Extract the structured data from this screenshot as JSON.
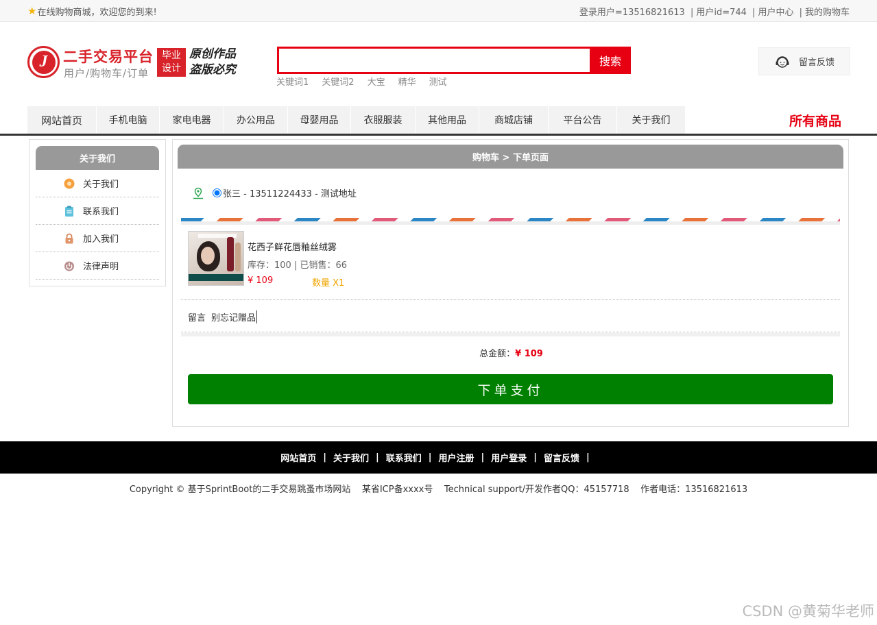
{
  "topbar": {
    "welcome": "在线购物商城，欢迎您的到来!",
    "login_user": "登录用户=13516821613",
    "user_id": "用户id=744",
    "user_center": "用户中心",
    "my_cart": "我的购物车",
    "sep": "|"
  },
  "header": {
    "logo_letter": "J",
    "logo_title": "二手交易平台",
    "logo_sub": "用户/购物车/订单",
    "badge_line1": "毕业",
    "badge_line2": "设计",
    "callig_line1": "原创作品",
    "callig_line2": "盗版必究",
    "search": {
      "value": "",
      "button_label": "搜索"
    },
    "keywords": [
      "关键词1",
      "关键词2",
      "大宝",
      "精华",
      "测试"
    ],
    "feedback_label": "留言反馈"
  },
  "nav": {
    "items": [
      "网站首页",
      "手机电脑",
      "家电电器",
      "办公用品",
      "母婴用品",
      "衣服服装",
      "其他用品",
      "商城店铺",
      "平台公告",
      "关于我们"
    ],
    "all_goods": "所有商品"
  },
  "sidebar": {
    "title": "关于我们",
    "items": [
      {
        "label": "关于我们",
        "icon": "orange-circle-icon"
      },
      {
        "label": "联系我们",
        "icon": "clipboard-icon"
      },
      {
        "label": "加入我们",
        "icon": "lock-icon"
      },
      {
        "label": "法律声明",
        "icon": "power-icon"
      }
    ]
  },
  "order": {
    "breadcrumb": "购物车 > 下单页面",
    "address": "张三 - 13511224433 - 测试地址",
    "product": {
      "name": "花西子鲜花唇釉丝绒雾",
      "stock": "库存：100 | 已销售：66",
      "price": "¥ 109",
      "qty": "数量 X1"
    },
    "note_label": "留言",
    "note_value": "别忘记赠品",
    "total_label": "总金额：",
    "total_value": "¥ 109",
    "pay_button": "下单支付"
  },
  "footer": {
    "links": [
      "网站首页",
      "关于我们",
      "联系我们",
      "用户注册",
      "用户登录",
      "留言反馈"
    ],
    "bar": "|",
    "copyright": "Copyright © 基于SprintBoot的二手交易跳蚤市场网站    某省ICP备xxxx号    Technical support/开发作者QQ：45157718    作者电话：13516821613"
  },
  "watermark": "CSDN @黄菊华老师",
  "colors": {
    "accent_red": "#e60012",
    "pay_green": "#008000",
    "header_gray": "#999999"
  }
}
